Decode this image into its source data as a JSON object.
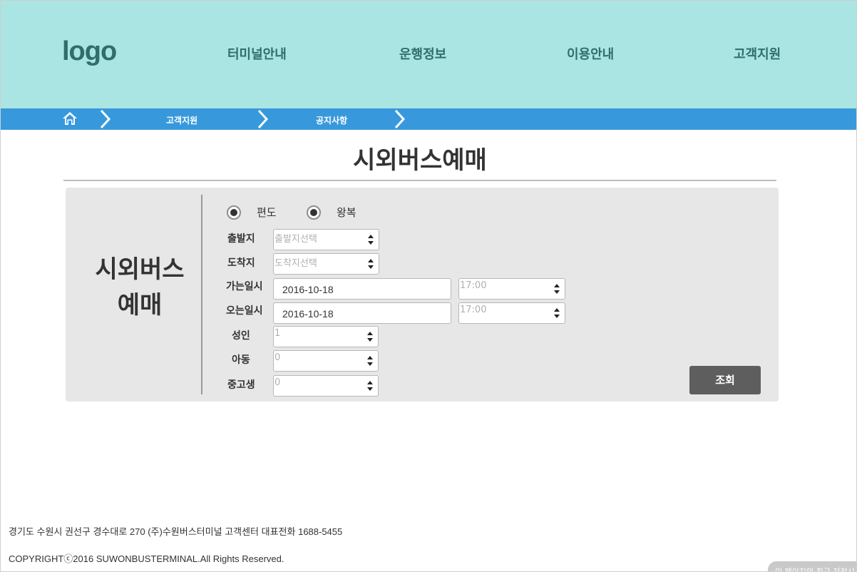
{
  "header": {
    "logo": "logo",
    "nav": [
      "터미널안내",
      "운행정보",
      "이용안내",
      "고객지원"
    ]
  },
  "breadcrumb": {
    "items": [
      "고객지원",
      "공지사항"
    ]
  },
  "main": {
    "page_title": "시외버스예매",
    "side_title_line1": "시외버스",
    "side_title_line2": "예매"
  },
  "form": {
    "trip_types": [
      {
        "label": "편도",
        "selected": true
      },
      {
        "label": "왕복",
        "selected": true
      }
    ],
    "departure": {
      "label": "출발지",
      "placeholder": "출발지선택"
    },
    "arrival": {
      "label": "도착지",
      "placeholder": "도착지선택"
    },
    "go_datetime": {
      "label": "가는일시",
      "date": "2016-10-18",
      "time": "17:00"
    },
    "return_datetime": {
      "label": "오는일시",
      "date": "2016-10-18",
      "time": "17:00"
    },
    "adult": {
      "label": "성인",
      "value": "1"
    },
    "child": {
      "label": "아동",
      "value": "0"
    },
    "student": {
      "label": "중고생",
      "value": "0"
    },
    "search_label": "조회"
  },
  "footer": {
    "address": "경기도 수원시 권선구 경수대로 270 (주)수원버스터미널  고객센터 대표전화  1688-5455",
    "copyright": "COPYRIGHTⓒ2016 SUWONBUSTERMINAL.All Rights Reserved.",
    "corner_note": "이 페이지의 최근 저장시"
  },
  "colors": {
    "header_bg": "#aae5e3",
    "breadcrumb_bg": "#3799dc",
    "panel_bg": "#e7e7e7",
    "button_bg": "#5e5e5e"
  },
  "icons": {
    "home": "home-icon",
    "separator": "chevron-right-icon",
    "select_arrows": "up-down-arrows-icon"
  }
}
